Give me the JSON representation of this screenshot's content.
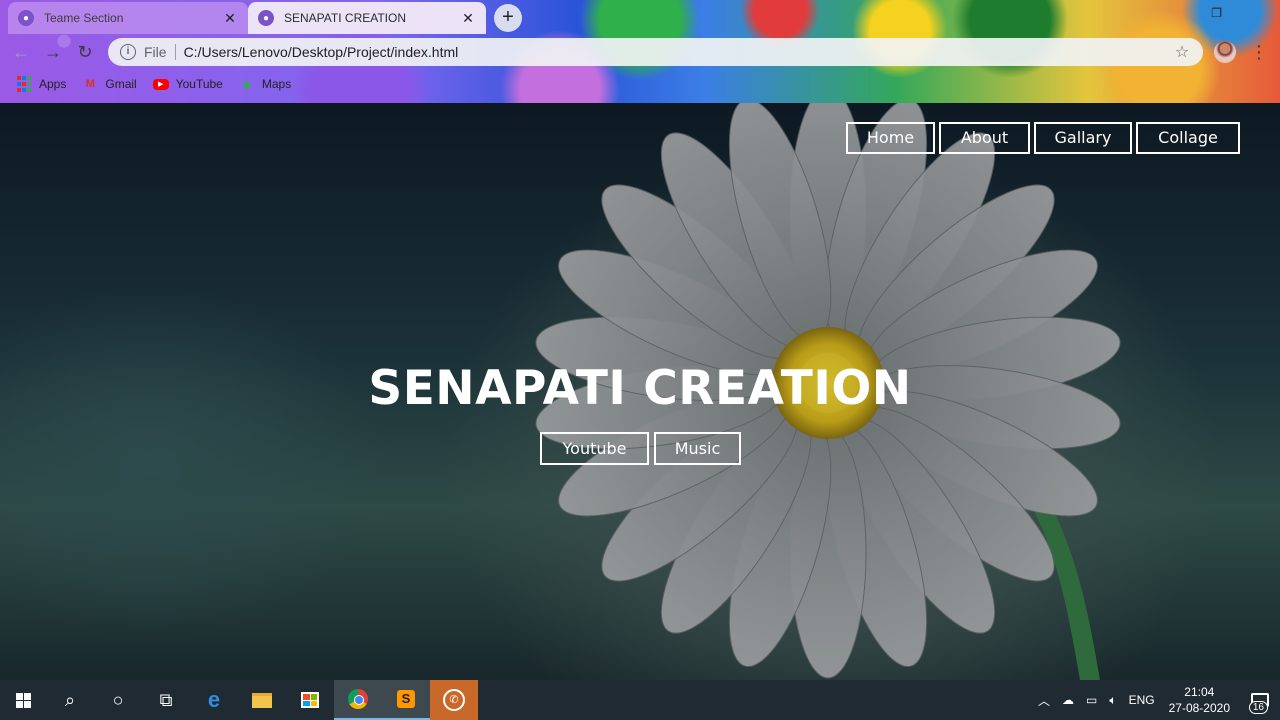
{
  "browser": {
    "tabs": [
      {
        "title": "Teame Section",
        "icon": "globe-icon",
        "active": false
      },
      {
        "title": "SENAPATI CREATION",
        "icon": "globe-icon",
        "active": true
      }
    ],
    "omnibox": {
      "scheme_label": "File",
      "url": "C:/Users/Lenovo/Desktop/Project/index.html"
    },
    "bookmarks": [
      {
        "label": "Apps",
        "icon": "apps-grid-icon"
      },
      {
        "label": "Gmail",
        "icon": "gmail-icon"
      },
      {
        "label": "YouTube",
        "icon": "youtube-icon"
      },
      {
        "label": "Maps",
        "icon": "maps-icon"
      }
    ]
  },
  "page": {
    "nav": [
      {
        "label": "Home"
      },
      {
        "label": "About"
      },
      {
        "label": "Gallary"
      },
      {
        "label": "Collage"
      }
    ],
    "hero": {
      "title": "SENAPATI CREATION",
      "buttons": [
        {
          "label": "Youtube"
        },
        {
          "label": "Music"
        }
      ]
    }
  },
  "taskbar": {
    "tray": {
      "language": "ENG",
      "time": "21:04",
      "date": "27-08-2020",
      "notification_count": "16"
    }
  },
  "colors": {
    "accent_border": "#ffffff",
    "taskbar": "#1f2a33",
    "active_tab": "#ece4f6"
  }
}
